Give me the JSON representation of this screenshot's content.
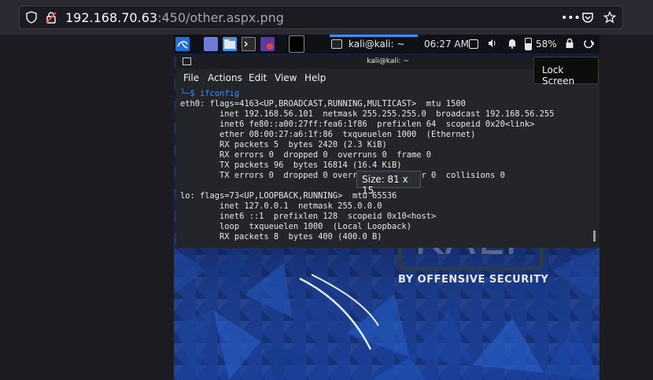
{
  "browser": {
    "url_host": "192.168.70.63",
    "url_rest": ":450/other.aspx.png",
    "more_icon": "•••"
  },
  "taskbar": {
    "window_title": "kali@kali: ~",
    "clock": "06:27 AM",
    "battery": "58%"
  },
  "terminal": {
    "title": "kali@kali: ~",
    "menu": [
      "File",
      "Actions",
      "Edit",
      "View",
      "Help"
    ],
    "prompt_prefix": "└─$",
    "command": "ifconfig",
    "lines": [
      "eth0: flags=4163<UP,BROADCAST,RUNNING,MULTICAST>  mtu 1500",
      "        inet 192.168.56.101  netmask 255.255.255.0  broadcast 192.168.56.255",
      "        inet6 fe80::a00:27ff:fea6:1f86  prefixlen 64  scopeid 0x20<link>",
      "        ether 08:00:27:a6:1f:86  txqueuelen 1000  (Ethernet)",
      "        RX packets 5  bytes 2420 (2.3 KiB)",
      "        RX errors 0  dropped 0  overruns 0  frame 0",
      "        TX packets 96  bytes 16814 (16.4 KiB)",
      "        TX errors 0  dropped 0 overruns 0  carrier 0  collisions 0",
      "",
      "lo: flags=73<UP,LOOPBACK,RUNNING>  mtu 65536",
      "        inet 127.0.0.1  netmask 255.0.0.0",
      "        inet6 ::1  prefixlen 128  scopeid 0x10<host>",
      "        loop  txqueuelen 1000  (Local Loopback)",
      "        RX packets 8  bytes 400 (400.0 B)"
    ]
  },
  "tooltips": {
    "lock_screen": "Lock Screen",
    "size": "Size: 81 x 15"
  },
  "wallpaper": {
    "brand": "KALI",
    "tagline": "BY OFFENSIVE SECURITY"
  }
}
